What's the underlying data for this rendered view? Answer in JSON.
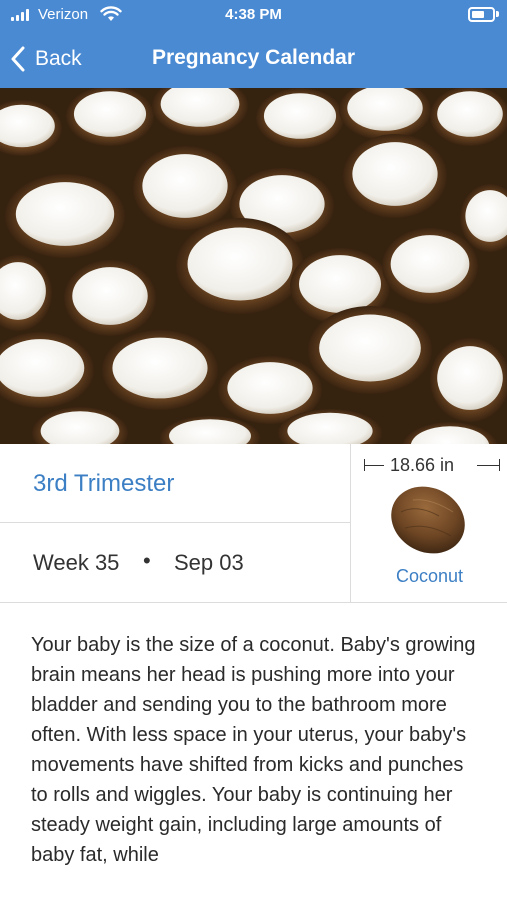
{
  "status_bar": {
    "carrier": "Verizon",
    "time": "4:38 PM"
  },
  "nav": {
    "back_label": "Back",
    "title": "Pregnancy Calendar"
  },
  "hero": {
    "icon": "coconut-photo"
  },
  "info": {
    "trimester": "3rd Trimester",
    "week": "Week 35",
    "separator": "•",
    "date": "Sep 03",
    "size": "18.66 in",
    "fruit": "Coconut"
  },
  "description": "Your baby is the size of a coconut. Baby's growing brain means her head is pushing more into your bladder and sending you to the bathroom more often. With less space in your uterus, your baby's movements have shifted from kicks and punches to rolls and wiggles. Your baby is continuing her steady weight gain, including large amounts of baby fat, while",
  "colors": {
    "header": "#4a8ad3",
    "accent": "#3c7fc4"
  }
}
